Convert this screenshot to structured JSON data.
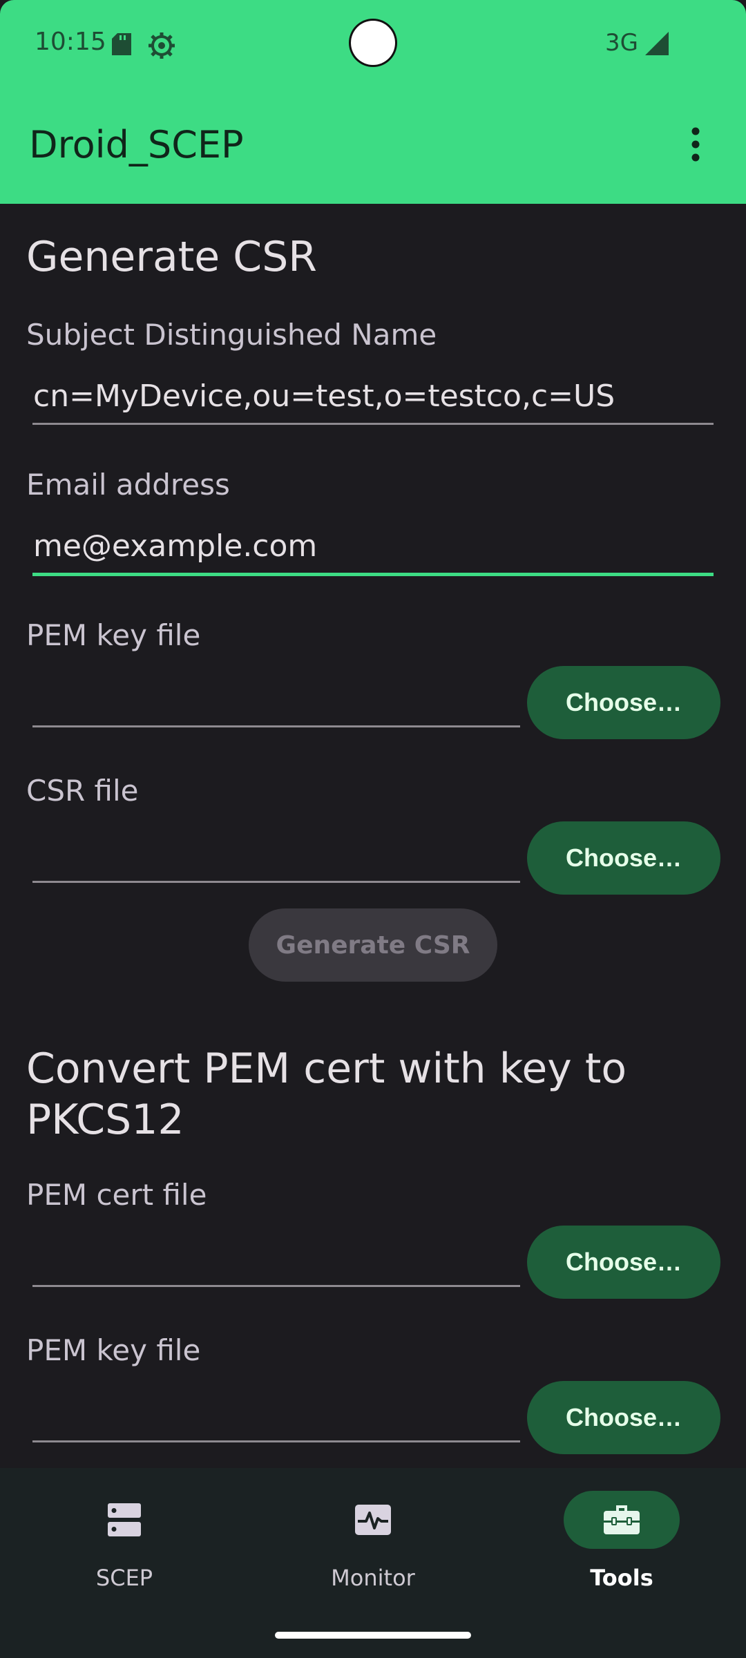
{
  "status_bar": {
    "time": "10:15",
    "network": "3G"
  },
  "app_bar": {
    "title": "Droid_SCEP"
  },
  "generate_csr": {
    "heading": "Generate CSR",
    "subject_label": "Subject Distinguished Name",
    "subject_value": "cn=MyDevice,ou=test,o=testco,c=US",
    "email_label": "Email address",
    "email_value": "me@example.com",
    "pem_key_label": "PEM key file",
    "pem_key_button": "Choose…",
    "csr_file_label": "CSR file",
    "csr_file_button": "Choose…",
    "generate_button": "Generate CSR"
  },
  "convert_pkcs12": {
    "heading_line1": "Convert PEM cert with key to",
    "heading_line2": "PKCS12",
    "pem_cert_label": "PEM cert file",
    "pem_cert_button": "Choose…",
    "pem_key_label": "PEM key file",
    "pem_key_button": "Choose…"
  },
  "bottom_nav": {
    "items": [
      {
        "label": "SCEP",
        "icon": "server-icon"
      },
      {
        "label": "Monitor",
        "icon": "monitor-heartbeat-icon"
      },
      {
        "label": "Tools",
        "icon": "toolbox-icon",
        "active": true
      }
    ]
  },
  "colors": {
    "accent": "#3ddc84",
    "button": "#1e5e3a",
    "background": "#1c1b1f"
  }
}
